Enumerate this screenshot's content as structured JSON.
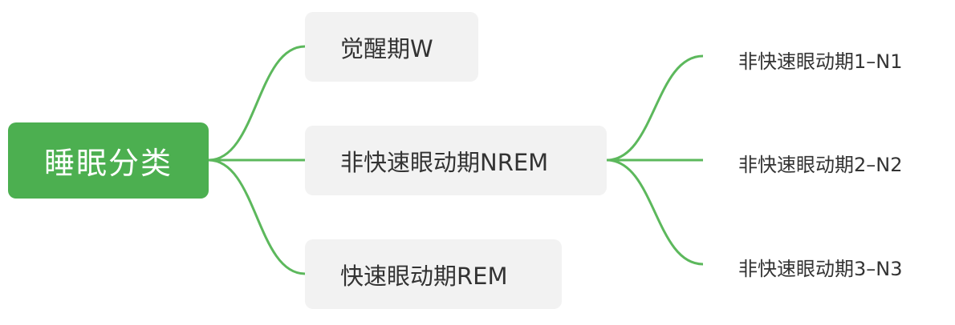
{
  "root": {
    "label": "睡眠分类"
  },
  "branches": [
    {
      "label": "觉醒期W"
    },
    {
      "label": "非快速眼动期NREM"
    },
    {
      "label": "快速眼动期REM"
    }
  ],
  "leaves": [
    {
      "label": "非快速眼动期1–N1"
    },
    {
      "label": "非快速眼动期2–N2"
    },
    {
      "label": "非快速眼动期3–N3"
    }
  ],
  "colors": {
    "accent": "#4caf50",
    "node_background": "#f2f2f2",
    "text": "#333333",
    "connector": "#5cb85c"
  }
}
